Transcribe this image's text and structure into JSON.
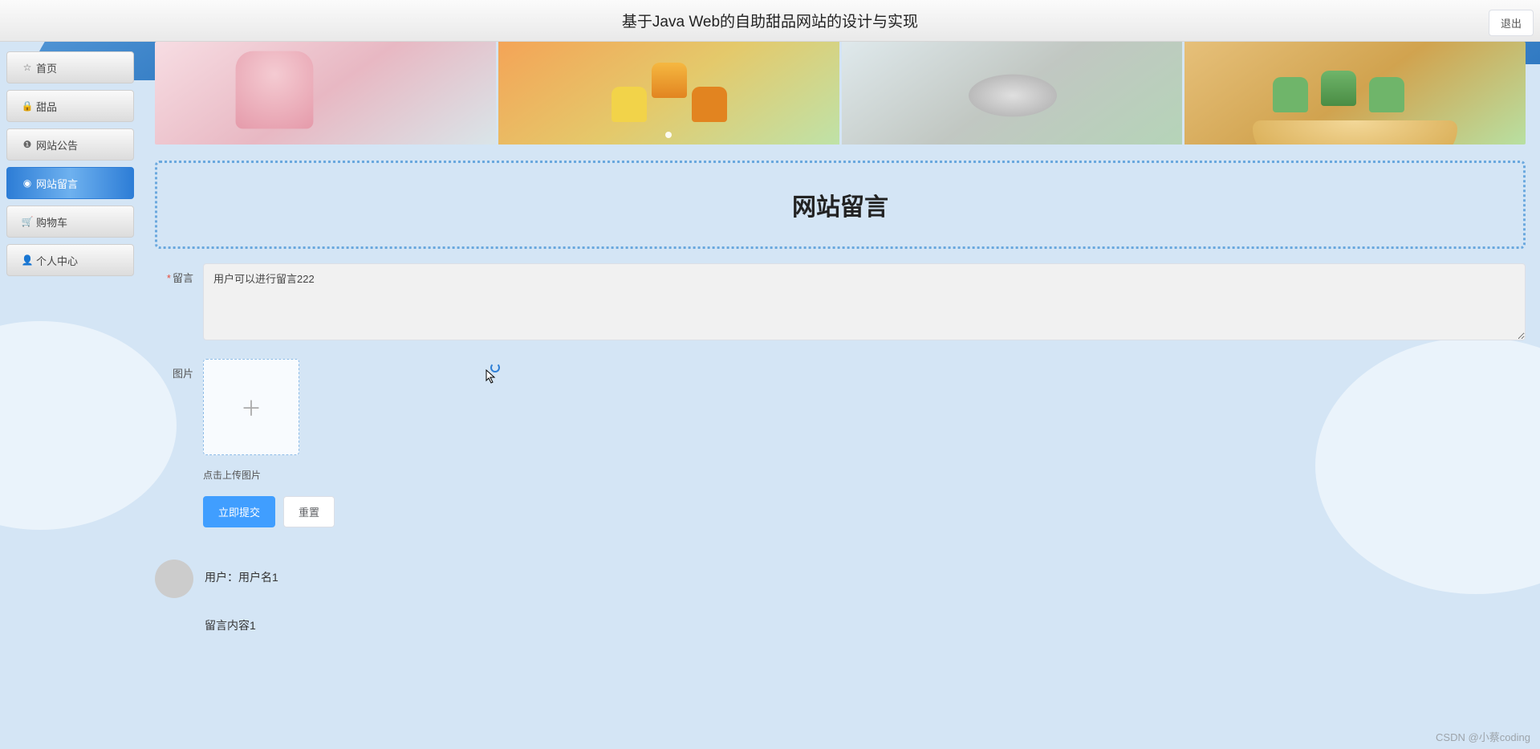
{
  "header": {
    "title": "基于Java Web的自助甜品网站的设计与实现",
    "logout": "退出"
  },
  "sidebar": {
    "items": [
      {
        "label": "首页",
        "icon": "☆"
      },
      {
        "label": "甜品",
        "icon": "🔒"
      },
      {
        "label": "网站公告",
        "icon": "❶"
      },
      {
        "label": "网站留言",
        "icon": "◉"
      },
      {
        "label": "购物车",
        "icon": "🛒"
      },
      {
        "label": "个人中心",
        "icon": "👤"
      }
    ],
    "active_index": 3
  },
  "page": {
    "section_title": "网站留言"
  },
  "form": {
    "message_label": "留言",
    "message_value": "用户可以进行留言222",
    "message_placeholder": "",
    "image_label": "图片",
    "upload_hint": "点击上传图片",
    "submit": "立即提交",
    "reset": "重置"
  },
  "comments": [
    {
      "user_prefix": "用户：",
      "user_name": "用户名1",
      "content": "留言内容1"
    }
  ],
  "watermark": "CSDN @小蔡coding"
}
